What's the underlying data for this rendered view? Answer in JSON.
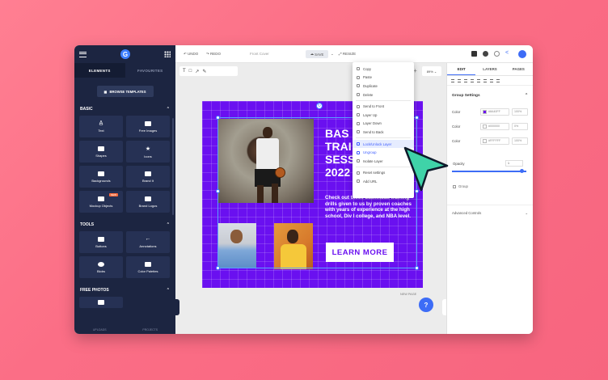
{
  "sidebar": {
    "logo": "G",
    "tabs": [
      "ELEMENTS",
      "FAVOURITES"
    ],
    "browse_label": "BROWSE TEMPLATES",
    "sections": [
      {
        "title": "BASIC",
        "items": [
          {
            "label": "Text",
            "icon": "text-icon"
          },
          {
            "label": "Free Images",
            "icon": "camera-icon"
          },
          {
            "label": "Shapes",
            "icon": "shapes-icon"
          },
          {
            "label": "Icons",
            "icon": "star-icon"
          },
          {
            "label": "Backgrounds",
            "icon": "backgrounds-icon"
          },
          {
            "label": "Brand It",
            "icon": "brand-icon"
          },
          {
            "label": "Mockup Objects",
            "icon": "mockup-icon",
            "badge": "NEW"
          },
          {
            "label": "Brand Logos",
            "icon": "logo-icon"
          }
        ]
      },
      {
        "title": "TOOLS",
        "items": [
          {
            "label": "Buttons",
            "icon": "button-icon"
          },
          {
            "label": "Annotations",
            "icon": "arrow-icon"
          },
          {
            "label": "Blobs",
            "icon": "blob-icon"
          },
          {
            "label": "Color Palettes",
            "icon": "palette-icon"
          }
        ]
      },
      {
        "title": "FREE PHOTOS",
        "items": []
      }
    ],
    "bottom_tabs": [
      "UPLOADS",
      "PROJECTS"
    ]
  },
  "topbar": {
    "undo": "UNDO",
    "redo": "REDO",
    "doc_name": "Front Cover",
    "save": "SAVE",
    "resize": "RESIZE"
  },
  "toolbar": {
    "zoom": "89%"
  },
  "context_menu": {
    "items": [
      "Copy",
      "Paste",
      "Duplicate",
      "Delete"
    ],
    "layer_items": [
      "Send to Front",
      "Layer Up",
      "Layer Down",
      "Send to Back"
    ],
    "group_items": [
      "Lock/Unlock Layer",
      "Ungroup",
      "Isolate Layer"
    ],
    "misc_items": [
      "Reset settings",
      "Add URL"
    ],
    "highlighted": "Lock/Unlock Layer"
  },
  "poster": {
    "title": "BASKETBALL\nTRAINING\nSESSIONS\n2022",
    "title_visible": "BAS\nTRAI\nSESS\n2022",
    "body": "Check out these basketball training drills given to us by proven coaches with years of experience at the high school, Div I college, and NBA level.",
    "button": "LEARN MORE",
    "bg_color": "#6a10f0"
  },
  "canvas": {
    "new_page": "NEW PAGE",
    "help": "?"
  },
  "right_panel": {
    "tabs": [
      "EDIT",
      "LAYERS",
      "PAGES"
    ],
    "section": "Group Settings",
    "colors": [
      {
        "label": "Color",
        "hex": "#8A40FF",
        "swatch": "#6a10f0",
        "pct": "100%"
      },
      {
        "label": "Color",
        "hex": "#000000",
        "swatch": "#ffffff",
        "pct": "0%"
      },
      {
        "label": "Color",
        "hex": "#FFFFFF",
        "swatch": "#ffffff",
        "pct": "100%"
      }
    ],
    "opacity_label": "Opacity",
    "opacity_value": "1",
    "group_label": "Group",
    "advanced": "Advanced Controls"
  }
}
